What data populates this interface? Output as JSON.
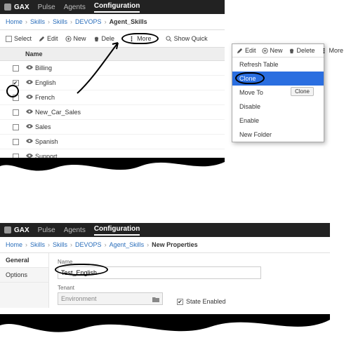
{
  "top": {
    "brand": "GAX",
    "nav": [
      "Pulse",
      "Agents",
      "Configuration"
    ],
    "nav_active": 2,
    "breadcrumb": [
      "Home",
      "Skills",
      "Skills",
      "DEVOPS",
      "Agent_Skills"
    ],
    "toolbar": {
      "select": "Select",
      "edit": "Edit",
      "new": "New",
      "delete": "Dele",
      "more": "More",
      "show_quick": "Show Quick"
    },
    "name_header": "Name",
    "rows": [
      {
        "name": "Billing",
        "checked": false
      },
      {
        "name": "English",
        "checked": true
      },
      {
        "name": "French",
        "checked": false
      },
      {
        "name": "New_Car_Sales",
        "checked": false
      },
      {
        "name": "Sales",
        "checked": false
      },
      {
        "name": "Spanish",
        "checked": false
      },
      {
        "name": "Support",
        "checked": false
      }
    ]
  },
  "popup": {
    "toolbar": {
      "edit": "Edit",
      "new": "New",
      "delete": "Delete",
      "more": "More"
    },
    "items": [
      "Refresh Table",
      "Clone",
      "Move To",
      "Disable",
      "Enable",
      "New Folder"
    ],
    "highlight_index": 1,
    "clone_button": "Clone"
  },
  "bottom": {
    "brand": "GAX",
    "nav": [
      "Pulse",
      "Agents",
      "Configuration"
    ],
    "nav_active": 2,
    "breadcrumb": [
      "Home",
      "Skills",
      "Skills",
      "DEVOPS",
      "Agent_Skills",
      "New Properties"
    ],
    "side": [
      "General",
      "Options"
    ],
    "side_active": 0,
    "form": {
      "name_label": "Name",
      "name_value": "Test_English",
      "tenant_label": "Tenant",
      "tenant_value": "Environment",
      "state_label": "State Enabled",
      "state_checked": true
    }
  }
}
